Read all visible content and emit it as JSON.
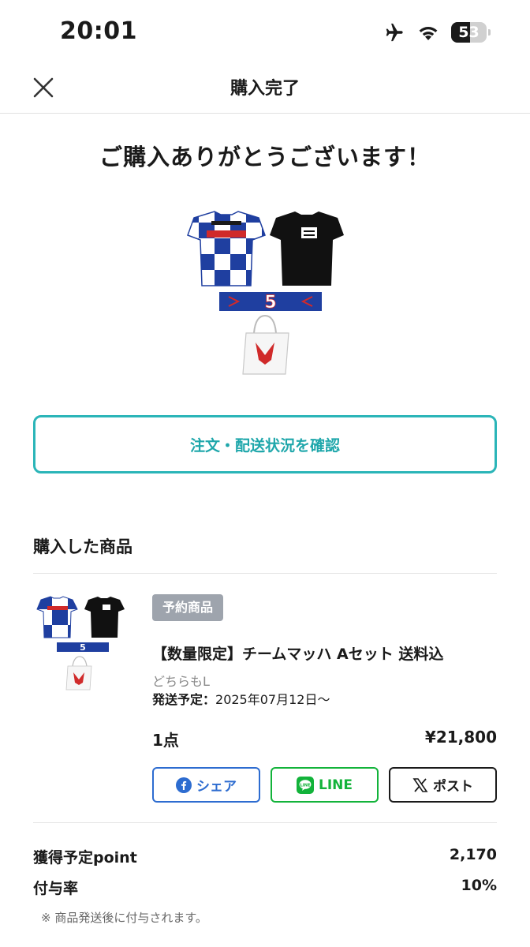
{
  "status_bar": {
    "time": "20:01",
    "battery": "53",
    "battery_level": 0.53
  },
  "nav": {
    "title": "購入完了"
  },
  "thanks_message": "ご購入ありがとうございます！",
  "order_status_button": "注文・配送状況を確認",
  "purchased_section": {
    "title": "購入した商品",
    "item": {
      "badge": "予約商品",
      "name": "【数量限定】チームマッハ Aセット 送料込",
      "variant": "どちらもL",
      "ship_label": "発送予定：",
      "ship_date": "2025年07月12日〜",
      "quantity": "1点",
      "price": "¥21,800"
    }
  },
  "share": {
    "facebook": "シェア",
    "line": "LINE",
    "x": "ポスト"
  },
  "points": {
    "earn_label": "獲得予定point",
    "earn_value": "2,170",
    "rate_label": "付与率",
    "rate_value": "10%",
    "note": "※ 商品発送後に付与されます。"
  },
  "colors": {
    "accent": "#2bb5b8",
    "facebook": "#2d6cd0",
    "line": "#12b33a",
    "badge": "#9ea4ad"
  },
  "icons": [
    "airplane-icon",
    "wifi-icon",
    "battery-icon",
    "close-icon",
    "facebook-icon",
    "line-icon",
    "x-icon"
  ]
}
